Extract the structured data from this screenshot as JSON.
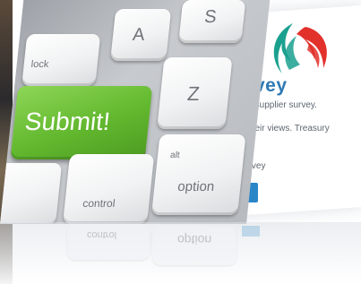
{
  "keyboard": {
    "keys": {
      "a": "A",
      "s": "S",
      "lock": "lock",
      "submit": "Submit!",
      "z": "Z",
      "control": "control",
      "alt": "alt",
      "option": "option"
    },
    "submit_color": "#62b82e"
  },
  "survey_card": {
    "title": "urvey",
    "line1": "ury supplier survey.",
    "line2": "r their views. Treasury",
    "line3": "urvey",
    "title_color": "#2e79b5",
    "button_color": "#2b86c8",
    "logo_colors": [
      "#1aa08f",
      "#e2312b"
    ]
  },
  "reflection": {
    "control": "control",
    "option": "option"
  }
}
